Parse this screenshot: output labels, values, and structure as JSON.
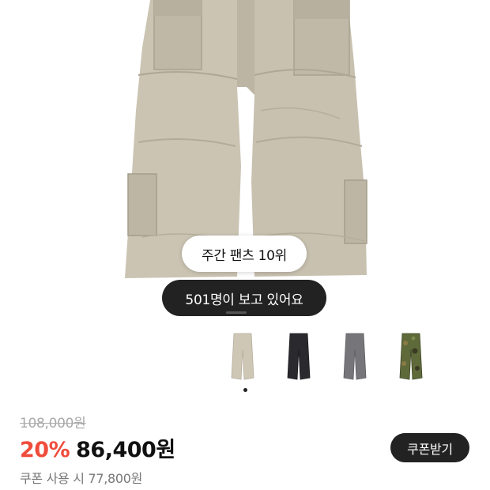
{
  "product": {
    "rank_badge": "주간 팬츠 10위",
    "viewers_badge": "501명이 보고 있어요",
    "image_icon": "cargo-pants-beige",
    "color_options": [
      {
        "name": "beige-cargo-pants-icon",
        "color": "#cfc7b6"
      },
      {
        "name": "black-cargo-pants-icon",
        "color": "#2a2a2e"
      },
      {
        "name": "gray-cargo-pants-icon",
        "color": "#76767a"
      },
      {
        "name": "camo-cargo-pants-icon",
        "color": "#5e6a3a"
      }
    ]
  },
  "pricing": {
    "original_price": "108,000원",
    "discount_rate": "20%",
    "sale_price": "86,400원",
    "coupon_price": "쿠폰 사용 시 77,800원",
    "coupon_button": "쿠폰받기",
    "discount_color": "#f04c3b"
  }
}
